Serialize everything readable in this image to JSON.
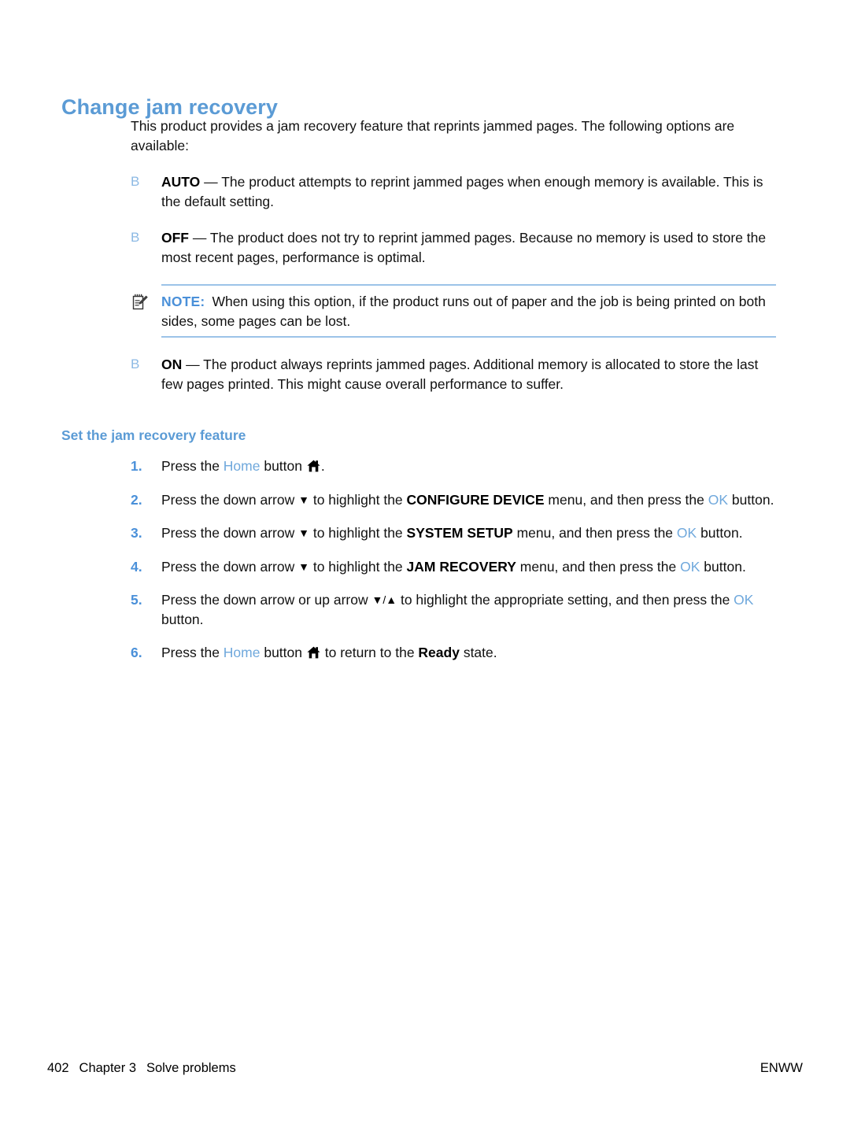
{
  "document": {
    "heading": "Change jam recovery",
    "intro": "This product provides a jam recovery feature that reprints jammed pages. The following options are available:",
    "bullet_symbol": "B",
    "options": [
      {
        "term": "AUTO",
        "dash": " — ",
        "text": "The product attempts to reprint jammed pages when enough memory is available. This is the default setting."
      },
      {
        "term": "OFF",
        "dash": " — ",
        "text": "The product does not try to reprint jammed pages. Because no memory is used to store the most recent pages, performance is optimal."
      },
      {
        "term": "ON",
        "dash": " — ",
        "text": "The product always reprints jammed pages. Additional memory is allocated to store the last few pages printed. This might cause overall performance to suffer."
      }
    ],
    "note": {
      "icon": "note-pencil-icon",
      "label": "NOTE:",
      "text": "When using this option, if the product runs out of paper and the job is being printed on both sides, some pages can be lost."
    },
    "subheading": "Set the jam recovery feature",
    "steps": [
      {
        "number": "1.",
        "parts": [
          {
            "type": "text",
            "value": "Press the "
          },
          {
            "type": "blue",
            "value": "Home"
          },
          {
            "type": "text",
            "value": " button "
          },
          {
            "type": "icon",
            "value": "home-icon"
          },
          {
            "type": "text",
            "value": "."
          }
        ]
      },
      {
        "number": "2.",
        "parts": [
          {
            "type": "text",
            "value": "Press the down arrow "
          },
          {
            "type": "arrow",
            "value": "▼"
          },
          {
            "type": "text",
            "value": " to highlight the "
          },
          {
            "type": "bold",
            "value": "CONFIGURE DEVICE"
          },
          {
            "type": "text",
            "value": " menu, and then press the "
          },
          {
            "type": "blue",
            "value": "OK"
          },
          {
            "type": "text",
            "value": " button."
          }
        ]
      },
      {
        "number": "3.",
        "parts": [
          {
            "type": "text",
            "value": "Press the down arrow "
          },
          {
            "type": "arrow",
            "value": "▼"
          },
          {
            "type": "text",
            "value": " to highlight the "
          },
          {
            "type": "bold",
            "value": "SYSTEM SETUP"
          },
          {
            "type": "text",
            "value": " menu, and then press the "
          },
          {
            "type": "blue",
            "value": "OK"
          },
          {
            "type": "text",
            "value": " button."
          }
        ]
      },
      {
        "number": "4.",
        "parts": [
          {
            "type": "text",
            "value": "Press the down arrow "
          },
          {
            "type": "arrow",
            "value": "▼"
          },
          {
            "type": "text",
            "value": " to highlight the "
          },
          {
            "type": "bold",
            "value": "JAM RECOVERY"
          },
          {
            "type": "text",
            "value": " menu, and then press the "
          },
          {
            "type": "blue",
            "value": "OK"
          },
          {
            "type": "text",
            "value": " button."
          }
        ]
      },
      {
        "number": "5.",
        "parts": [
          {
            "type": "text",
            "value": "Press the down arrow or up arrow "
          },
          {
            "type": "arrow",
            "value": "▼/▲"
          },
          {
            "type": "text",
            "value": " to highlight the appropriate setting, and then press the "
          },
          {
            "type": "blue",
            "value": "OK"
          },
          {
            "type": "text",
            "value": " button."
          }
        ]
      },
      {
        "number": "6.",
        "parts": [
          {
            "type": "text",
            "value": "Press the "
          },
          {
            "type": "blue",
            "value": "Home"
          },
          {
            "type": "text",
            "value": " button "
          },
          {
            "type": "icon",
            "value": "home-icon"
          },
          {
            "type": "text",
            "value": " to return to the "
          },
          {
            "type": "bold",
            "value": "Ready"
          },
          {
            "type": "text",
            "value": " state."
          }
        ]
      }
    ],
    "footer": {
      "page_number": "402",
      "chapter": "Chapter 3",
      "chapter_title": "Solve problems",
      "locale": "ENWW"
    },
    "colors": {
      "heading_blue": "#5B9BD5",
      "link_blue": "#6FA8DC",
      "bullet_blue": "#8CB9E4",
      "rule_blue": "#9CC3E8",
      "body_black": "#111111"
    }
  }
}
